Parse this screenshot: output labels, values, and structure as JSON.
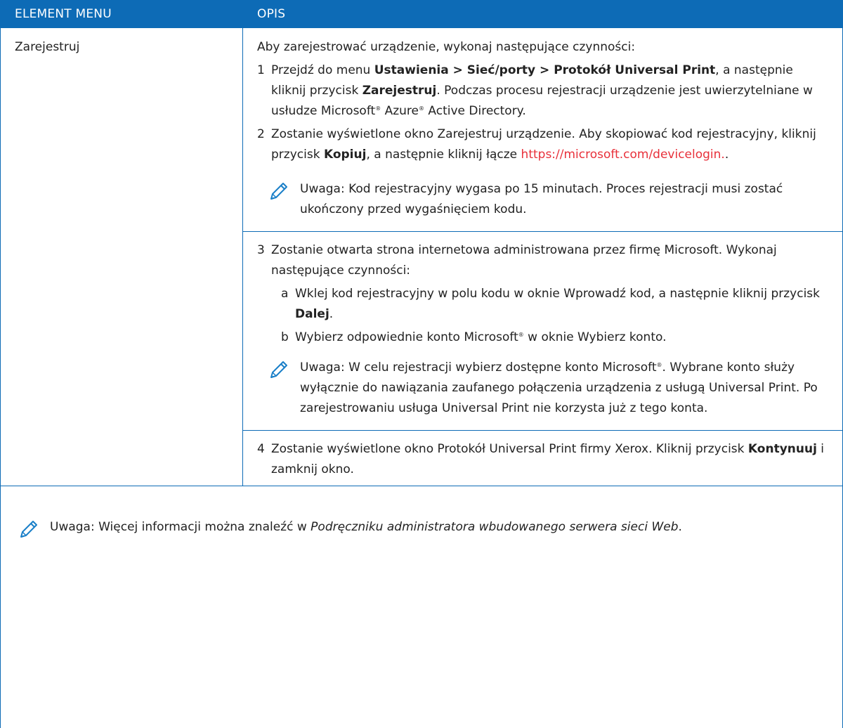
{
  "table": {
    "header_col1": "ELEMENT MENU",
    "header_col2": "OPIS",
    "row_label": "Zarejestruj",
    "intro": "Aby zarejestrować urządzenie, wykonaj następujące czynności:",
    "step1": {
      "num": "1",
      "t1": "Przejdź do menu ",
      "b1": "Ustawienia > Sieć/porty > Protokół Universal Print",
      "t2": ", a następnie kliknij przycisk ",
      "b2": "Zarejestruj",
      "t3": ". Podczas procesu rejestracji urządzenie jest uwierzytelniane w usłudze Microsoft",
      "sup1": "®",
      "t4": " Azure",
      "sup2": "®",
      "t5": " Active Directory."
    },
    "step2": {
      "num": "2",
      "t1": "Zostanie wyświetlone okno Zarejestruj urządzenie. Aby skopiować kod rejestracyjny, kliknij przycisk ",
      "b1": "Kopiuj",
      "t2": ", a następnie kliknij łącze ",
      "link": "https://microsoft.com/devicelogin.",
      "t3": "."
    },
    "note1": "Uwaga: Kod rejestracyjny wygasa po 15 minutach. Proces rejestracji musi zostać ukończony przed wygaśnięciem kodu.",
    "step3": {
      "num": "3",
      "t1": "Zostanie otwarta strona internetowa administrowana przez firmę Microsoft. Wykonaj następujące czynności:",
      "sub_a": {
        "letter": "a",
        "t1": "Wklej kod rejestracyjny w polu kodu w oknie Wprowadź kod, a następnie kliknij przycisk ",
        "b1": "Dalej",
        "t2": "."
      },
      "sub_b": {
        "letter": "b",
        "t1": "Wybierz odpowiednie konto Microsoft",
        "sup": "®",
        "t2": " w oknie Wybierz konto."
      }
    },
    "note2": {
      "t1": "Uwaga: W celu rejestracji wybierz dostępne konto Microsoft",
      "sup": "®",
      "t2": ". Wybrane konto służy wyłącznie do nawiązania zaufanego połączenia urządzenia z usługą Universal Print. Po zarejestrowaniu usługa Universal Print nie korzysta już z tego konta."
    },
    "step4": {
      "num": "4",
      "t1": "Zostanie wyświetlone okno Protokół Universal Print firmy Xerox. Kliknij przycisk ",
      "b1": "Kontynuuj",
      "t2": " i zamknij okno."
    },
    "footer_note": {
      "t1": "Uwaga: Więcej informacji można znaleźć w ",
      "i1": "Podręczniku administratora wbudowanego serwera sieci Web",
      "t2": "."
    }
  },
  "icons": {
    "note_icon": "pencil-icon",
    "accent_color": "#0d6bb6",
    "link_color": "#e8303a"
  }
}
